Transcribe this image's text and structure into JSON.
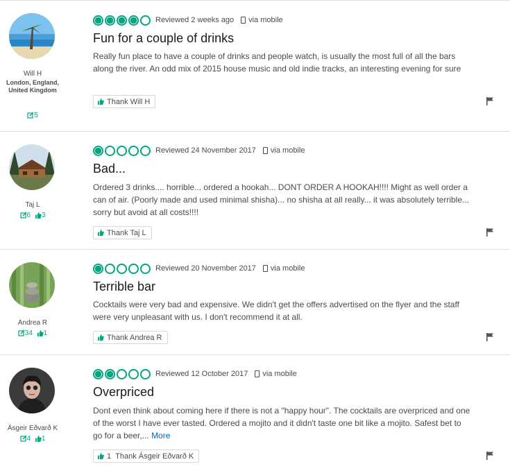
{
  "reviews": [
    {
      "user": {
        "name": "Will H",
        "location": "London, England, United Kingdom",
        "reviews_count": "5",
        "helpful_count": null
      },
      "rating": 4,
      "reviewed_date": "Reviewed 2 weeks ago",
      "via": "via mobile",
      "title": "Fun for a couple of drinks",
      "body": "Really fun place to have a couple of drinks and people watch, is usually the most full of all the bars along the river. An odd mix of 2015 house music and old indie tracks, an interesting evening for sure",
      "more": null,
      "thank_count": null,
      "thank_label": "Thank Will H"
    },
    {
      "user": {
        "name": "Taj L",
        "location": null,
        "reviews_count": "6",
        "helpful_count": "3"
      },
      "rating": 1,
      "reviewed_date": "Reviewed 24 November 2017",
      "via": "via mobile",
      "title": "Bad...",
      "body": "Ordered 3 drinks.... horrible... ordered a hookah... DONT ORDER A HOOKAH!!!! Might as well order a can of air. (Poorly made and used minimal shisha)... no shisha at all really... it was absolutely terrible... sorry but avoid at all costs!!!!",
      "more": null,
      "thank_count": null,
      "thank_label": "Thank Taj L"
    },
    {
      "user": {
        "name": "Andrea R",
        "location": null,
        "reviews_count": "34",
        "helpful_count": "1"
      },
      "rating": 1,
      "reviewed_date": "Reviewed 20 November 2017",
      "via": "via mobile",
      "title": "Terrible bar",
      "body": "Cocktails were very bad and expensive. We didn't get the offers advertised on the flyer and the staff were very unpleasant with us. I don't recommend it at all.",
      "more": null,
      "thank_count": null,
      "thank_label": "Thank Andrea R"
    },
    {
      "user": {
        "name": "Ásgeir Eðvarð K",
        "location": null,
        "reviews_count": "4",
        "helpful_count": "1"
      },
      "rating": 2,
      "reviewed_date": "Reviewed 12 October 2017",
      "via": "via mobile",
      "title": "Overpriced",
      "body": "Dont even think about coming here if there is not a \"happy hour\". The cocktails are overpriced and one of the worst I have ever tasted. Ordered a mojito and it didn't taste one bit like a mojito. Safest bet to go for a beer,...",
      "more": "More",
      "thank_count": "1",
      "thank_label": "Thank Ásgeir Eðvarð K"
    }
  ],
  "colors": {
    "accent": "#00a680",
    "link": "#0066cc",
    "text": "#4a4a4a",
    "title": "#1a1a1a",
    "divider": "#e0e0e0"
  },
  "icons": [
    "review-count-icon",
    "helpful-thumb-icon",
    "mobile-phone-icon",
    "thumbs-up-icon",
    "flag-icon",
    "rating-bubble-icon"
  ]
}
